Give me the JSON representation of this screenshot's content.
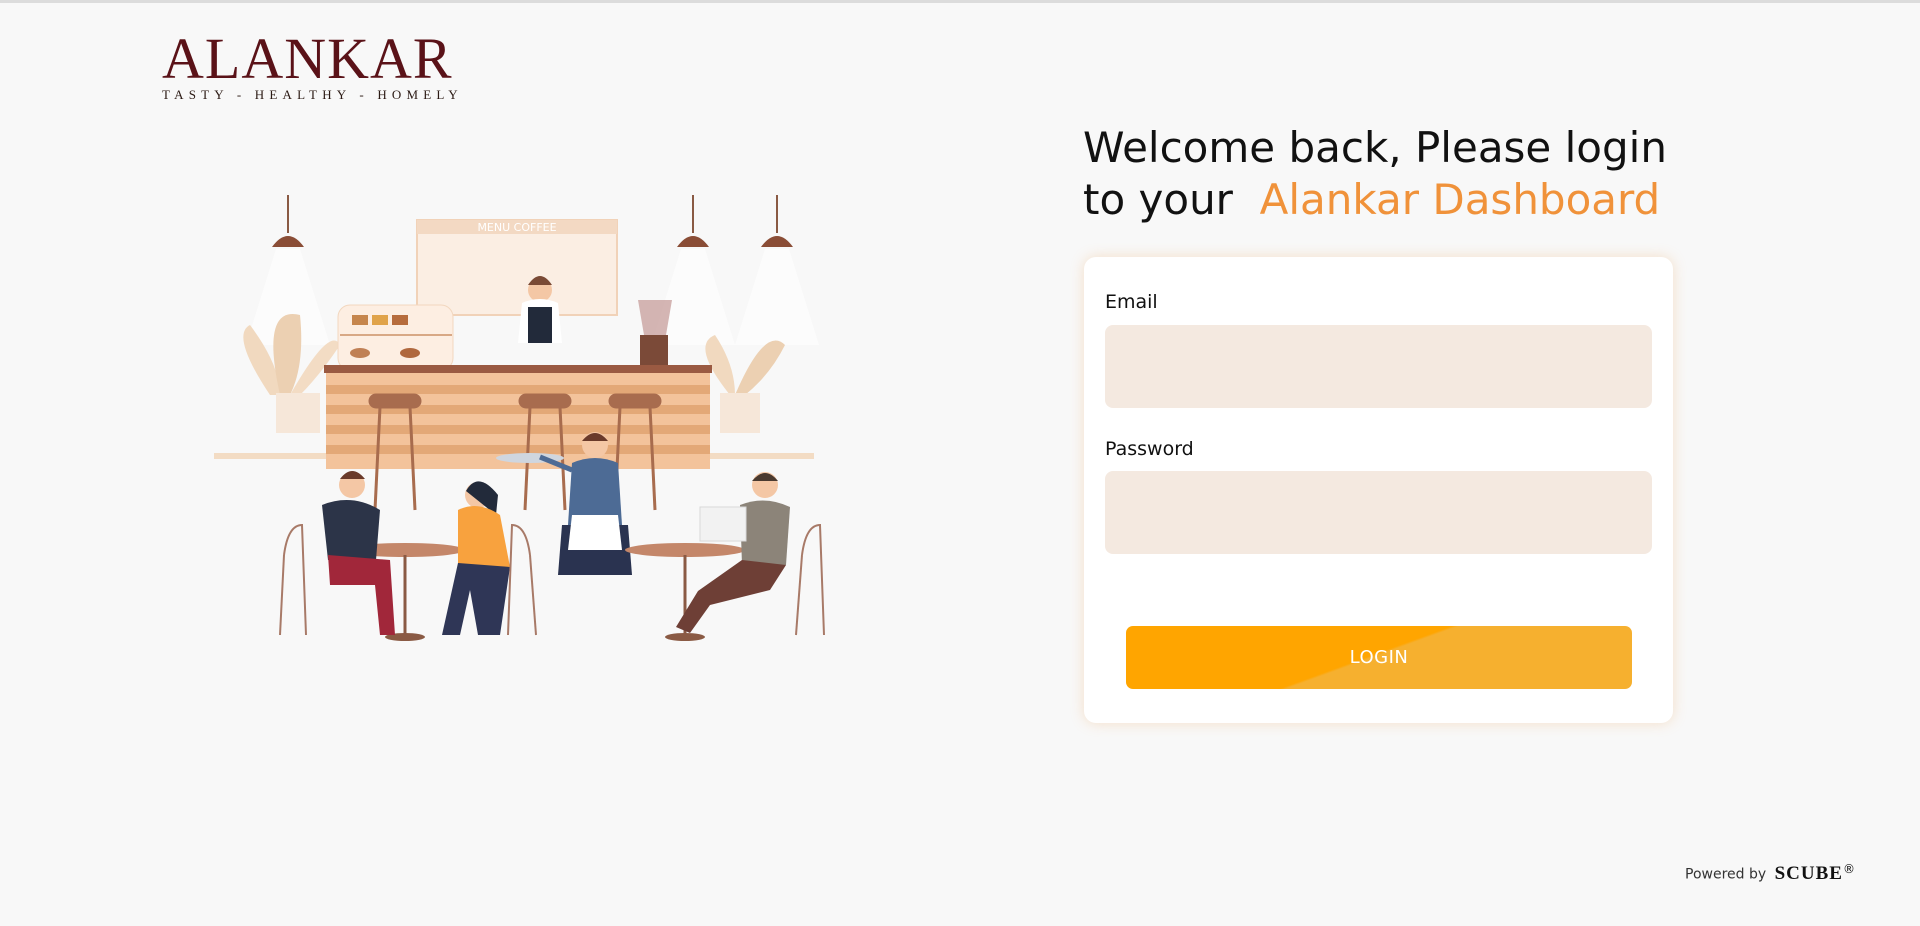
{
  "brand": {
    "name": "ALANKAR",
    "tagline": "TASTY  -  HEALTHY  -  HOMELY"
  },
  "illustration": {
    "menu_board_text": "MENU COFFEE"
  },
  "welcome": {
    "line": "Welcome back, Please login to your",
    "highlight": "Alankar Dashboard"
  },
  "form": {
    "email_label": "Email",
    "email_value": "",
    "password_label": "Password",
    "password_value": "",
    "login_label": "LOGIN"
  },
  "footer": {
    "powered_by": "Powered by",
    "company": "SCUBE",
    "registered_mark": "®"
  },
  "colors": {
    "accent": "#f0923a",
    "button": "#ffa500",
    "input_bg": "#f4e9e0",
    "brand": "#5a1218"
  }
}
